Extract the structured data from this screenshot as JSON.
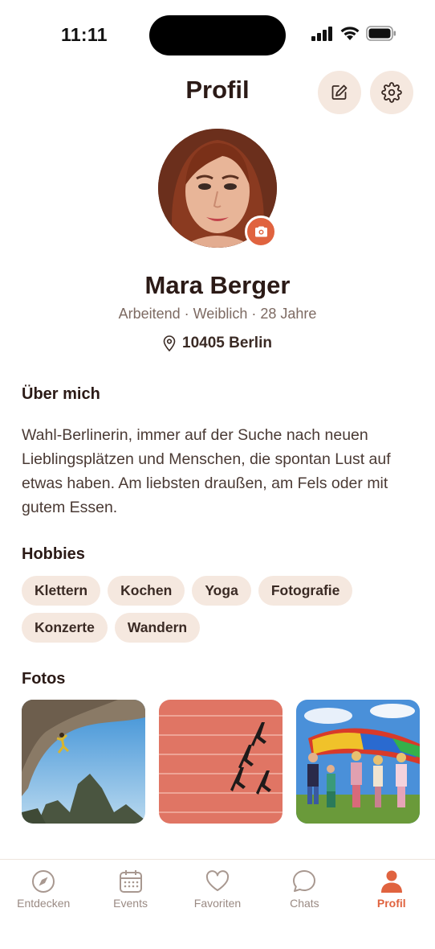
{
  "status_bar": {
    "time": "11:11",
    "icons": [
      "signal-icon",
      "wifi-icon",
      "battery-icon"
    ]
  },
  "header": {
    "title": "Profil",
    "edit_icon": "edit-icon",
    "settings_icon": "gear-icon"
  },
  "profile": {
    "name": "Mara Berger",
    "meta": "Arbeitend · Weiblich · 28 Jahre",
    "location": "10405 Berlin",
    "camera_icon": "camera-icon"
  },
  "about": {
    "title": "Über mich",
    "text": "Wahl-Berlinerin, immer auf der Suche nach neuen Lieblingsplätzen und Menschen, die spontan Lust auf etwas haben. Am liebsten draußen, am Fels oder mit gutem Essen."
  },
  "hobbies": {
    "title": "Hobbies",
    "items": [
      "Klettern",
      "Kochen",
      "Yoga",
      "Fotografie",
      "Konzerte",
      "Wandern"
    ]
  },
  "photos": {
    "title": "Fotos",
    "count": 3
  },
  "tabs": [
    {
      "label": "Entdecken",
      "icon": "compass-icon",
      "active": false
    },
    {
      "label": "Events",
      "icon": "calendar-icon",
      "active": false
    },
    {
      "label": "Favoriten",
      "icon": "heart-icon",
      "active": false
    },
    {
      "label": "Chats",
      "icon": "chat-bubble-icon",
      "active": false
    },
    {
      "label": "Profil",
      "icon": "person-icon",
      "active": true
    }
  ],
  "colors": {
    "accent": "#e0633f",
    "chip_bg": "#f5e8df",
    "text": "#2b1a16",
    "muted": "#7d6a62"
  }
}
